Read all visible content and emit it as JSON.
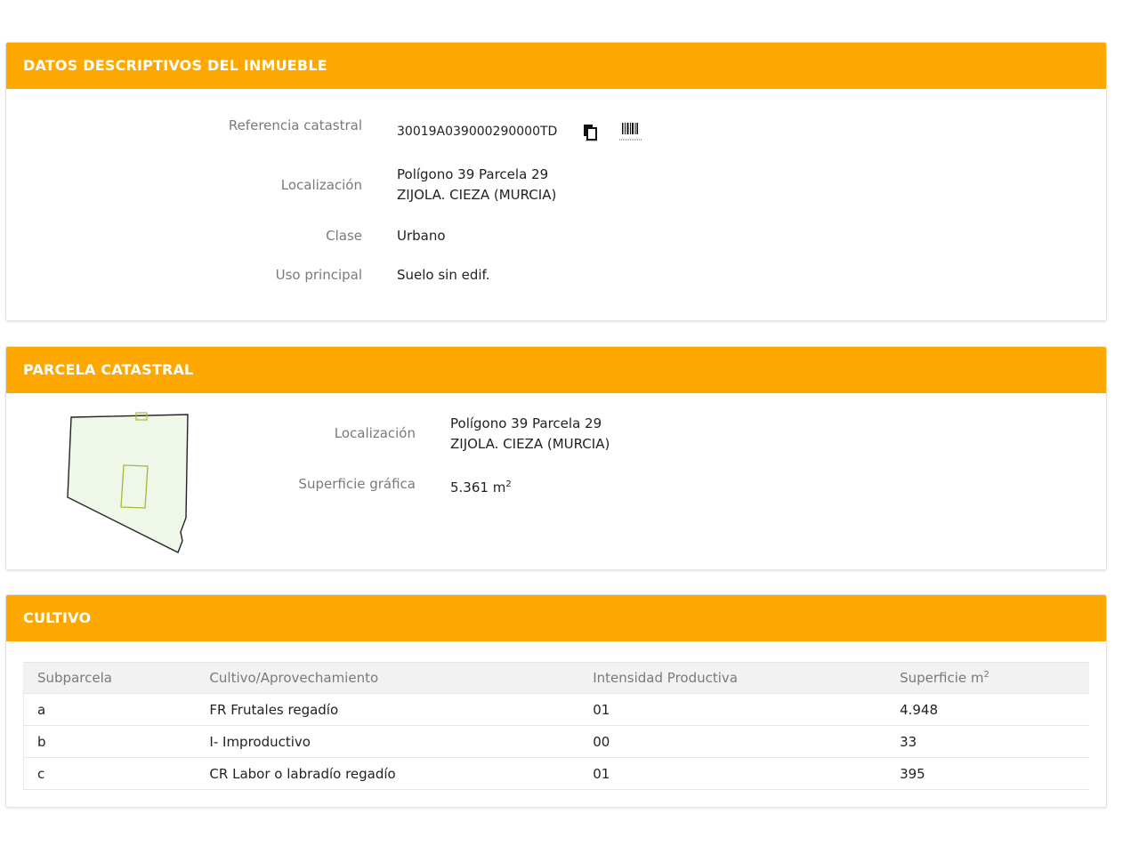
{
  "inmueble": {
    "header": "DATOS DESCRIPTIVOS DEL INMUEBLE",
    "referencia_label": "Referencia catastral",
    "referencia_value": "30019A039000290000TD",
    "copy_icon": "copy-document-icon",
    "barcode_icon": "barcode-icon",
    "localizacion_label": "Localización",
    "localizacion_line1": "Polígono 39 Parcela 29",
    "localizacion_line2": "ZIJOLA. CIEZA (MURCIA)",
    "clase_label": "Clase",
    "clase_value": "Urbano",
    "uso_label": "Uso principal",
    "uso_value": "Suelo sin edif."
  },
  "parcela": {
    "header": "PARCELA CATASTRAL",
    "localizacion_label": "Localización",
    "localizacion_line1": "Polígono 39 Parcela 29",
    "localizacion_line2": "ZIJOLA. CIEZA (MURCIA)",
    "superficie_label": "Superficie gráfica",
    "superficie_value": "5.361 m",
    "superficie_exp": "2",
    "map_icon": "parcel-map-icon",
    "colors": {
      "parcel_fill": "#eef7e8",
      "building_outline": "#a9b833"
    }
  },
  "cultivo": {
    "header": "CULTIVO",
    "columns": [
      "Subparcela",
      "Cultivo/Aprovechamiento",
      "Intensidad Productiva",
      "Superficie m"
    ],
    "superficie_exp": "2",
    "rows": [
      [
        "a",
        "FR Frutales regadío",
        "01",
        "4.948"
      ],
      [
        "b",
        "I- Improductivo",
        "00",
        "33"
      ],
      [
        "c",
        "CR Labor o labradío regadío",
        "01",
        "395"
      ]
    ]
  },
  "colors": {
    "header_bg": "#fca800",
    "header_text": "#ffffff",
    "label_text": "#7a7a7a"
  }
}
